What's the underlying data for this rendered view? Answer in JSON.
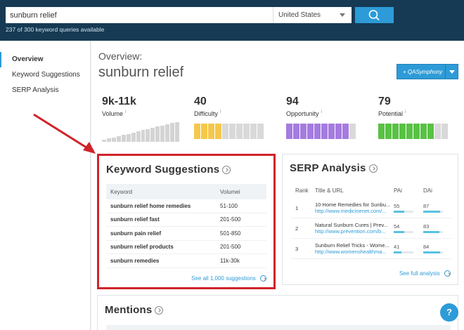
{
  "search": {
    "query": "sunburn relief",
    "country": "United States",
    "queries_available": "237 of 300 keyword queries available"
  },
  "sidebar": {
    "items": [
      {
        "label": "Overview"
      },
      {
        "label": "Keyword Suggestions"
      },
      {
        "label": "SERP Analysis"
      }
    ]
  },
  "overview": {
    "label": "Overview:",
    "keyword": "sunburn relief",
    "button": "+ QASymphony"
  },
  "metrics": [
    {
      "value": "9k-11k",
      "label": "Volume"
    },
    {
      "value": "40",
      "label": "Difficulty",
      "fraction": 0.4,
      "color": "#f5c84c"
    },
    {
      "value": "94",
      "label": "Opportunity",
      "fraction": 0.94,
      "color": "#a57be0"
    },
    {
      "value": "79",
      "label": "Potential",
      "fraction": 0.79,
      "color": "#58c244"
    }
  ],
  "keyword_suggestions": {
    "title": "Keyword Suggestions",
    "headers": {
      "keyword": "Keyword",
      "volume": "Volume"
    },
    "rows": [
      {
        "keyword": "sunburn relief home remedies",
        "volume": "51-100"
      },
      {
        "keyword": "sunburn relief fast",
        "volume": "201-500"
      },
      {
        "keyword": "sunburn pain relief",
        "volume": "501-850"
      },
      {
        "keyword": "sunburn relief products",
        "volume": "201-500"
      },
      {
        "keyword": "sunburn remedies",
        "volume": "11k-30k"
      }
    ],
    "see_all": "See all 1,000 suggestions"
  },
  "serp_analysis": {
    "title": "SERP Analysis",
    "headers": {
      "rank": "Rank",
      "title": "Title & URL",
      "pa": "PA",
      "da": "DA"
    },
    "rows": [
      {
        "rank": "1",
        "title": "10 Home Remedies for Sunbu...",
        "url": "http://www.medicinenet.com/...",
        "pa": "55",
        "da": "87"
      },
      {
        "rank": "2",
        "title": "Natural Sunburn Cures | Prev...",
        "url": "http://www.prevention.com/b...",
        "pa": "54",
        "da": "83"
      },
      {
        "rank": "3",
        "title": "Sunburn Relief Tricks - Wome...",
        "url": "http://www.womenshealthma...",
        "pa": "41",
        "da": "84"
      }
    ],
    "see_full": "See full analysis"
  },
  "mentions": {
    "title": "Mentions"
  },
  "help": {
    "label": "?"
  }
}
